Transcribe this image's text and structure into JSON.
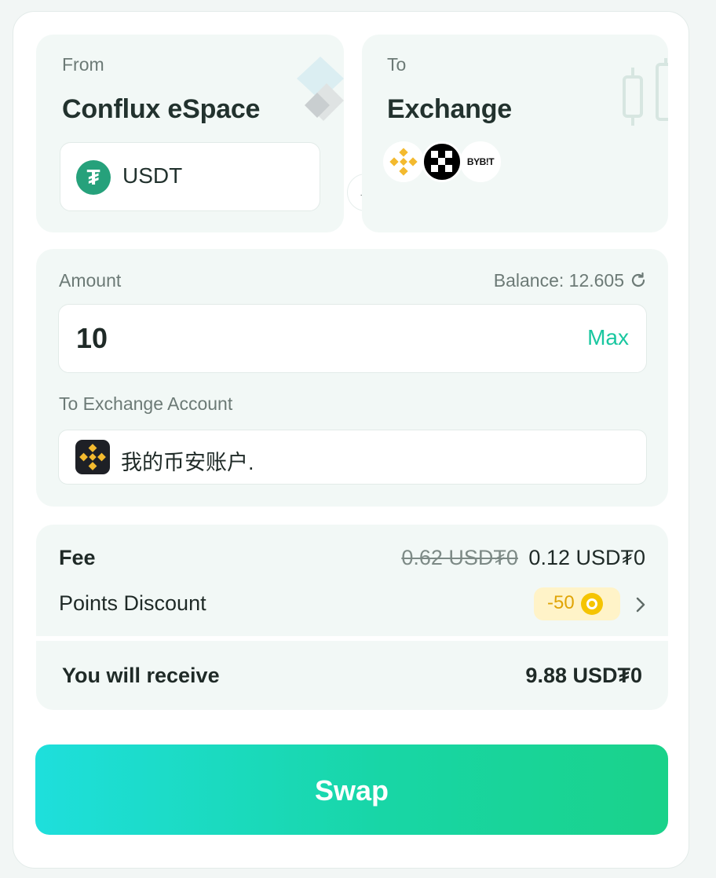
{
  "from": {
    "label": "From",
    "network": "Conflux eSpace",
    "token": "USDT",
    "token_icon": "tether-icon"
  },
  "to": {
    "label": "To",
    "destination": "Exchange",
    "exchanges": [
      {
        "name": "Binance",
        "icon": "binance-icon"
      },
      {
        "name": "OKX",
        "icon": "okx-icon"
      },
      {
        "name": "BYBIT",
        "text": "BYB!T",
        "icon": "bybit-icon"
      }
    ]
  },
  "amount": {
    "label": "Amount",
    "balance": "Balance: 12.605",
    "value": "10",
    "max_label": "Max"
  },
  "account": {
    "label": "To Exchange Account",
    "name": "我的币安账户."
  },
  "fee": {
    "label": "Fee",
    "original": "0.62 USD₮0",
    "discounted": "0.12 USD₮0",
    "points_label": "Points Discount",
    "points_value": "-50"
  },
  "receive": {
    "label": "You will receive",
    "value": "9.88 USD₮0"
  },
  "swap_label": "Swap",
  "colors": {
    "accent": "#19c7a0",
    "tether": "#26a17b",
    "binance": "#f3ba2f",
    "points_bg": "#fff3c8"
  }
}
